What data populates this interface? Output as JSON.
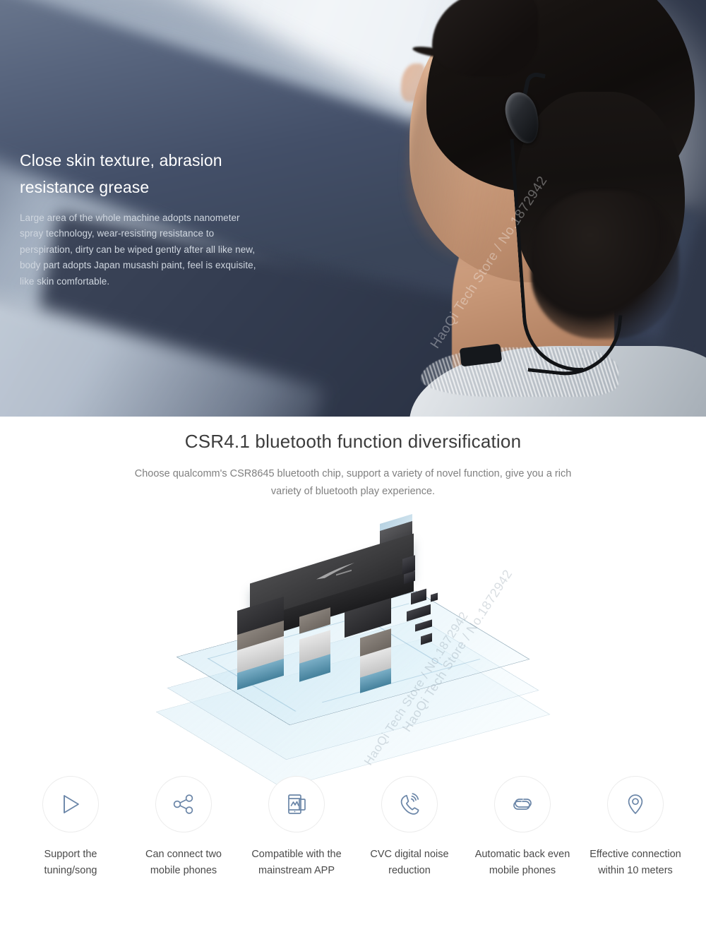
{
  "hero": {
    "title": "Close skin texture, abrasion resistance grease",
    "body": "Large area of the whole machine adopts nanometer spray technology, wear-resisting resistance to perspiration, dirty can be wiped gently after all like new, body part adopts Japan musashi paint, feel is exquisite, like skin comfortable.",
    "watermark": "HaoQi Tech Store / No.1872942",
    "photo_alt": "man-wearing-bluetooth-earbud"
  },
  "chip_section": {
    "title": "CSR4.1 bluetooth function diversification",
    "subtitle": "Choose qualcomm's CSR8645 bluetooth chip, support a variety of novel function, give you a rich variety of bluetooth play experience.",
    "illustration_alt": "exploded-bluetooth-chip-diagram",
    "watermark": "HaoQi Tech Store / No.1872942"
  },
  "features": {
    "watermark": "HaoQi Tech Store / No.1872942",
    "items": [
      {
        "icon": "play-icon",
        "label": "Support the\ntuning/song"
      },
      {
        "icon": "share-nodes-icon",
        "label": "Can connect two\nmobile phones"
      },
      {
        "icon": "mobile-app-icon",
        "label": "Compatible with the\nmainstream APP"
      },
      {
        "icon": "phone-call-waves-icon",
        "label": "CVC digital noise\nreduction"
      },
      {
        "icon": "chain-link-icon",
        "label": "Automatic back even\nmobile phones"
      },
      {
        "icon": "location-pin-icon",
        "label": "Effective connection\nwithin 10 meters"
      }
    ]
  },
  "colors": {
    "icon_stroke": "#6b86a8",
    "circle_border": "#ececec",
    "title_text": "#3c3c3c",
    "body_text": "#808080",
    "label_text": "#4a4a4a",
    "hero_title_text": "#ffffff",
    "hero_body_text": "#cfd6df"
  }
}
